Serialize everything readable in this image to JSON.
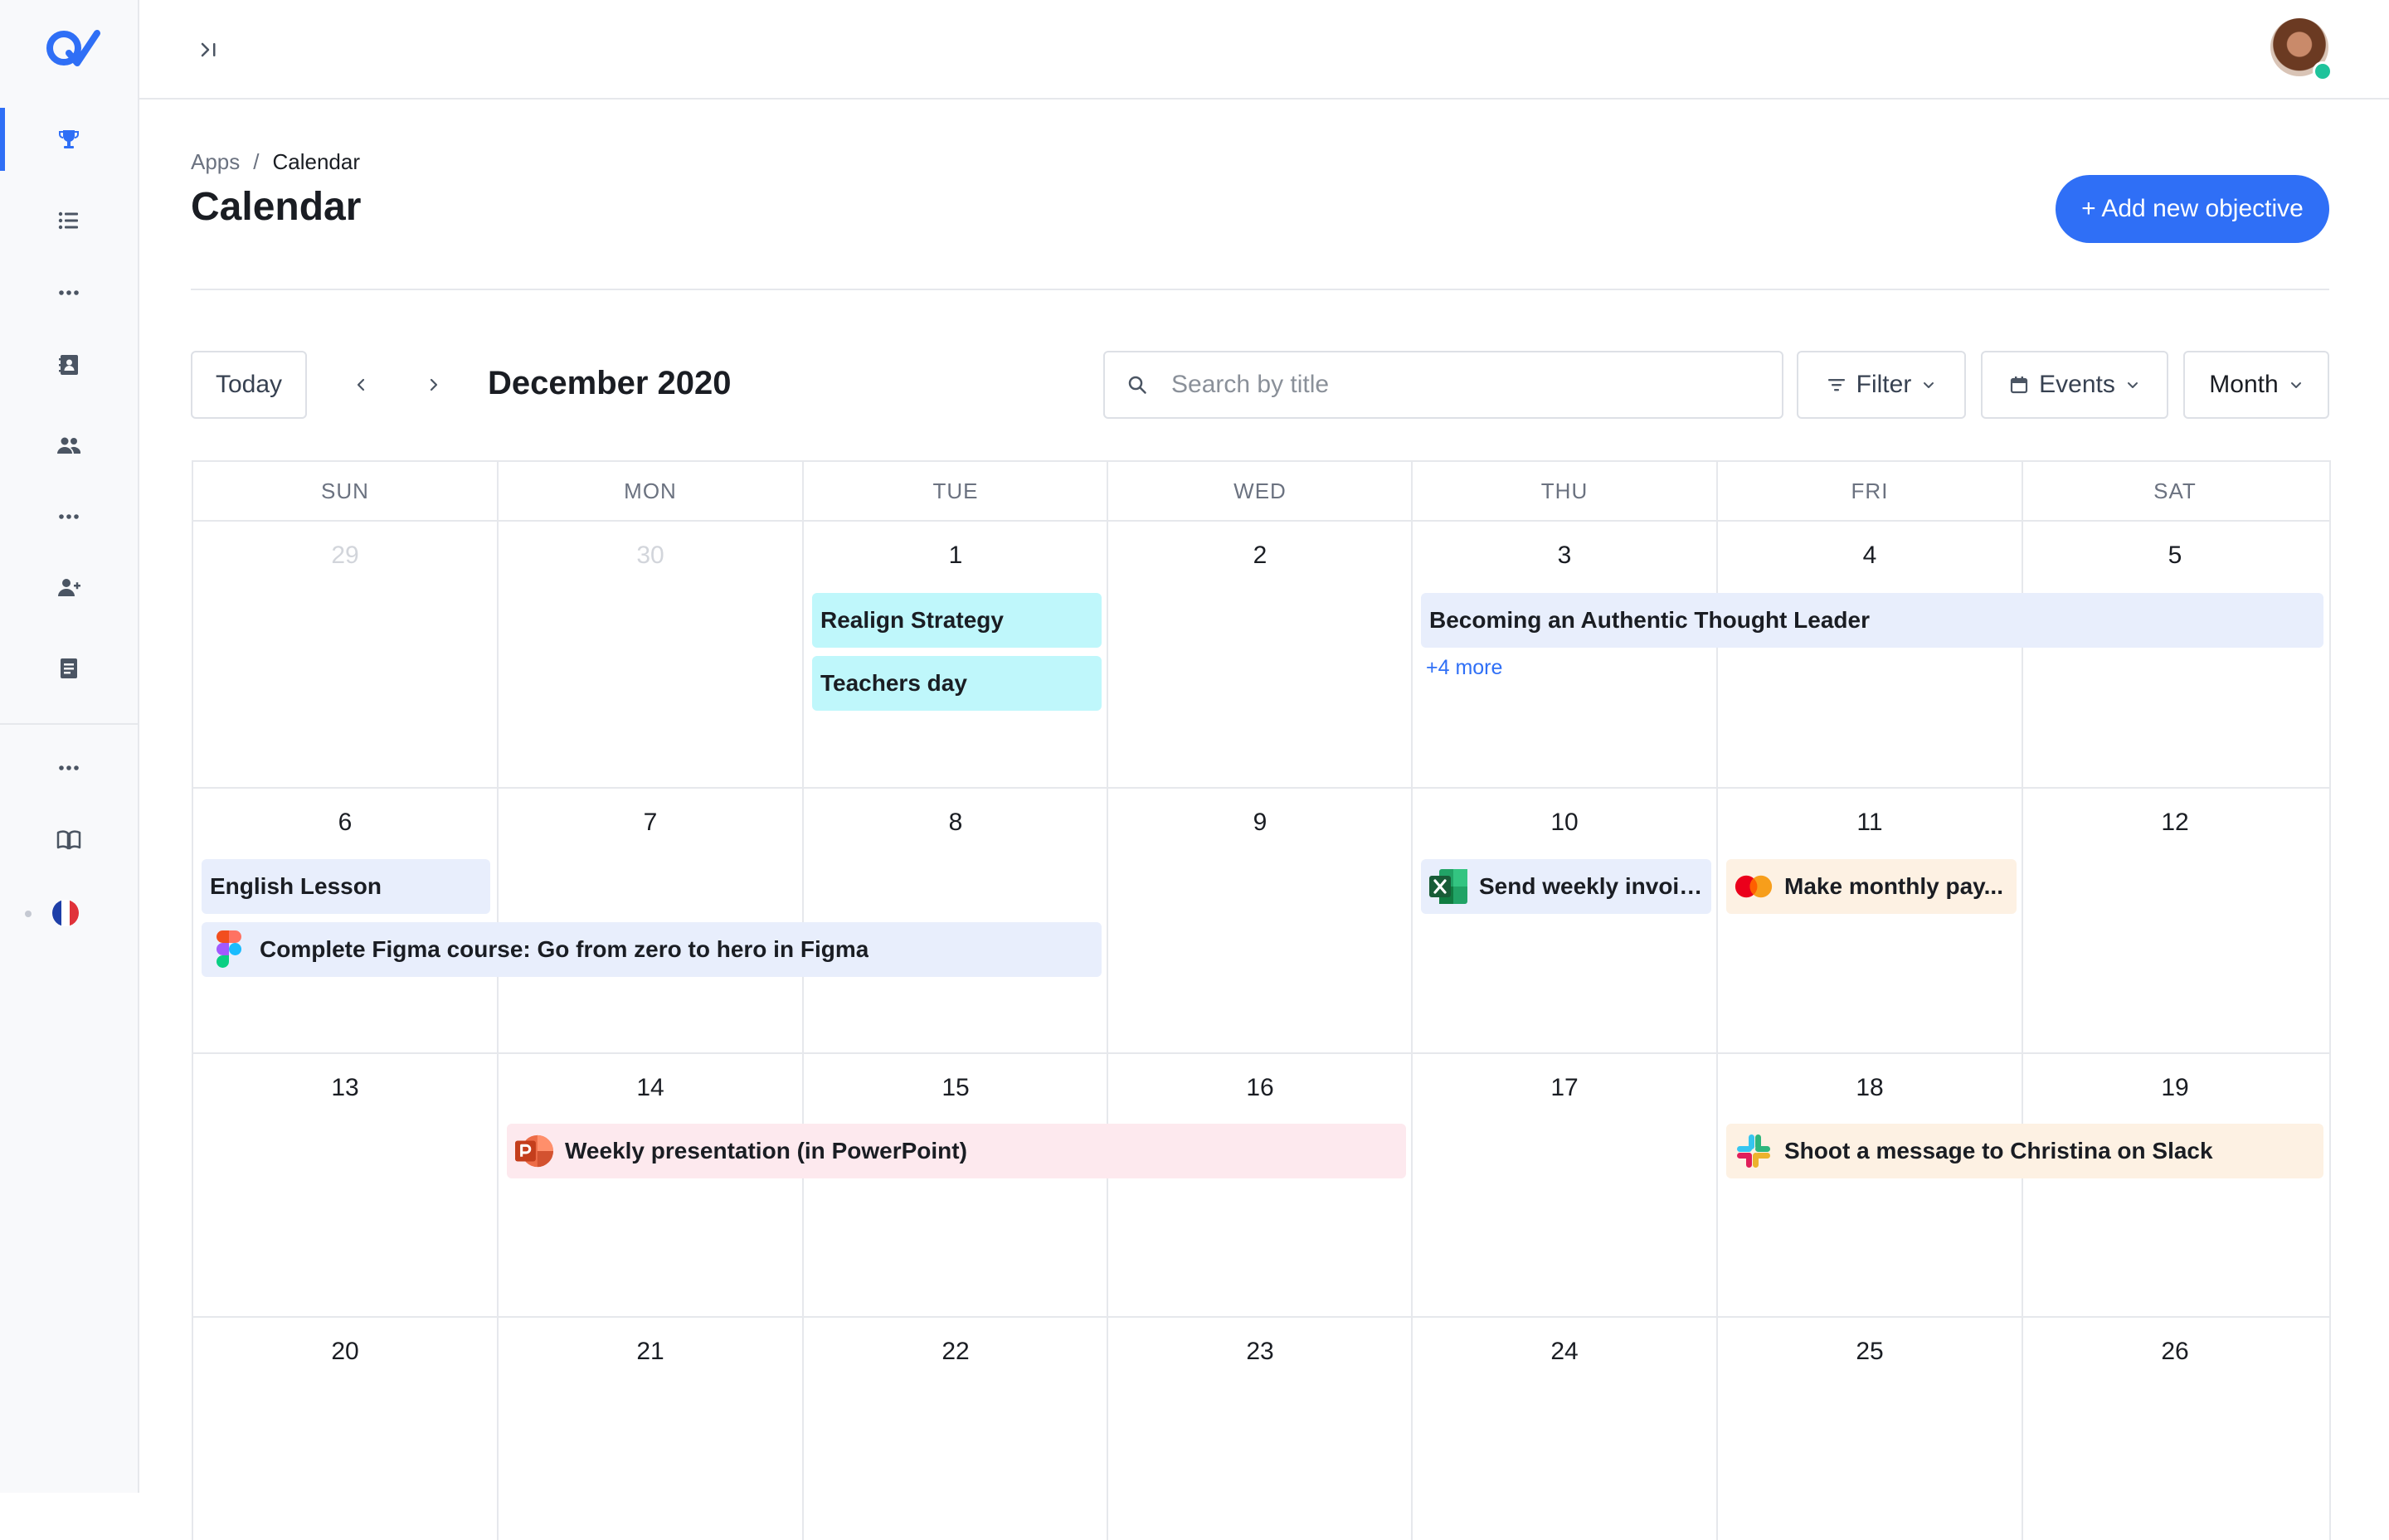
{
  "sidebar": {
    "logo_icon": "q-check-logo",
    "items": [
      {
        "icon": "trophy-icon",
        "active": true
      },
      {
        "icon": "list-icon"
      },
      {
        "icon": "more-icon"
      },
      {
        "icon": "contacts-book-icon"
      },
      {
        "icon": "users-icon"
      },
      {
        "icon": "more-icon"
      },
      {
        "icon": "user-add-icon"
      },
      {
        "icon": "document-icon"
      },
      {
        "icon": "more-icon"
      },
      {
        "icon": "open-book-icon"
      },
      {
        "icon": "france-flag-icon"
      }
    ],
    "accent": "#2f6ff6"
  },
  "topbar": {
    "collapse_icon": "collapse-right-icon",
    "avatar_status": "online"
  },
  "breadcrumb": {
    "root": "Apps",
    "separator": "/",
    "current": "Calendar"
  },
  "page": {
    "title": "Calendar",
    "add_button": "+ Add new objective"
  },
  "toolbar": {
    "today": "Today",
    "month_label": "December 2020",
    "search_placeholder": "Search by title",
    "filter": "Filter",
    "events": "Events",
    "view": "Month"
  },
  "weekdays": [
    "SUN",
    "MON",
    "TUE",
    "WED",
    "THU",
    "FRI",
    "SAT"
  ],
  "weeks": [
    [
      {
        "n": "29",
        "muted": true
      },
      {
        "n": "30",
        "muted": true
      },
      {
        "n": "1"
      },
      {
        "n": "2"
      },
      {
        "n": "3"
      },
      {
        "n": "4"
      },
      {
        "n": "5"
      }
    ],
    [
      {
        "n": "6"
      },
      {
        "n": "7"
      },
      {
        "n": "8"
      },
      {
        "n": "9"
      },
      {
        "n": "10"
      },
      {
        "n": "11"
      },
      {
        "n": "12"
      }
    ],
    [
      {
        "n": "13"
      },
      {
        "n": "14"
      },
      {
        "n": "15"
      },
      {
        "n": "16"
      },
      {
        "n": "17"
      },
      {
        "n": "18"
      },
      {
        "n": "19"
      }
    ],
    [
      {
        "n": "20"
      },
      {
        "n": "21"
      },
      {
        "n": "22"
      },
      {
        "n": "23"
      },
      {
        "n": "24"
      },
      {
        "n": "25"
      },
      {
        "n": "26"
      }
    ]
  ],
  "events": {
    "realign": "Realign Strategy",
    "teachers": "Teachers day",
    "authentic": "Becoming an Authentic Thought Leader",
    "more": "+4 more",
    "english": "English Lesson",
    "figma": "Complete Figma course: Go from zero to hero in Figma",
    "invoice": "Send weekly invoic...",
    "payment": "Make monthly pay...",
    "powerpoint": "Weekly presentation (in PowerPoint)",
    "slack": "Shoot a message to Christina on Slack"
  },
  "event_colors": {
    "cyan": "#bff7fb",
    "blue": "#e8eefc",
    "pink": "#fde9ee",
    "peach": "#fdf1e3"
  }
}
